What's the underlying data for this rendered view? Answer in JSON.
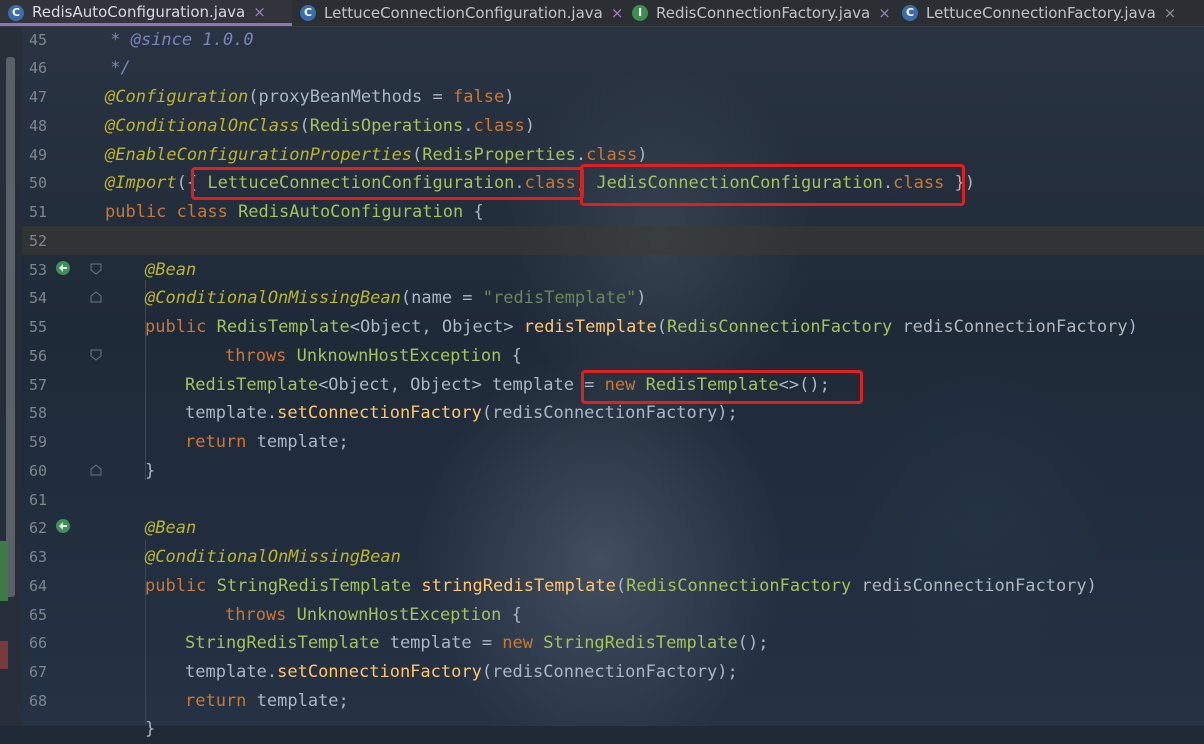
{
  "tabs": [
    {
      "label": "RedisAutoConfiguration.java",
      "icon": "C",
      "active": true
    },
    {
      "label": "LettuceConnectionConfiguration.java",
      "icon": "C",
      "active": false
    },
    {
      "label": "RedisConnectionFactory.java",
      "icon": "I",
      "active": false
    },
    {
      "label": "LettuceConnectionFactory.java",
      "icon": "C",
      "active": false
    }
  ],
  "close_glyph": "×",
  "line_numbers": [
    "45",
    "46",
    "47",
    "48",
    "49",
    "50",
    "51",
    "52",
    "53",
    "54",
    "55",
    "56",
    "57",
    "58",
    "59",
    "60",
    "61",
    "62",
    "63",
    "64",
    "65",
    "66",
    "67",
    "68"
  ],
  "code": {
    "l45_a": " * ",
    "l45_b": "@since",
    "l45_c": " 1.0.0",
    "l46": " */",
    "l47_a": "@Configuration",
    "l47_b": "(proxyBeanMethods = ",
    "l47_c": "false",
    "l47_d": ")",
    "l48_a": "@ConditionalOnClass",
    "l48_b": "(",
    "l48_c": "RedisOperations",
    "l48_d": ".",
    "l48_e": "class",
    "l48_f": ")",
    "l49_a": "@EnableConfigurationProperties",
    "l49_b": "(",
    "l49_c": "RedisProperties",
    "l49_d": ".",
    "l49_e": "class",
    "l49_f": ")",
    "l50_a": "@Import",
    "l50_b": "({ ",
    "l50_c": "LettuceConnectionConfiguration",
    "l50_d": ".",
    "l50_e": "class",
    "l50_f": ", ",
    "l50_g": "JedisConnectionConfiguration",
    "l50_h": ".",
    "l50_i": "class",
    "l50_j": " })",
    "l51_a": "public class ",
    "l51_b": "RedisAutoConfiguration",
    "l51_c": " {",
    "l53": "@Bean",
    "l54_a": "@ConditionalOnMissingBean",
    "l54_b": "(name = ",
    "l54_c": "\"redisTemplate\"",
    "l54_d": ")",
    "l55_a": "public ",
    "l55_b": "RedisTemplate",
    "l55_c": "<Object, Object> ",
    "l55_d": "redisTemplate",
    "l55_e": "(",
    "l55_f": "RedisConnectionFactory ",
    "l55_g": "redisConnectionFactory",
    "l55_h": ")",
    "l56_a": "throws ",
    "l56_b": "UnknownHostException",
    "l56_c": " {",
    "l57_a": "RedisTemplate",
    "l57_b": "<Object, Object> template = ",
    "l57_c": "new ",
    "l57_d": "RedisTemplate",
    "l57_e": "<>();",
    "l58_a": "template.",
    "l58_b": "setConnectionFactory",
    "l58_c": "(redisConnectionFactory);",
    "l59_a": "return ",
    "l59_b": "template;",
    "l60": "}",
    "l62": "@Bean",
    "l63": "@ConditionalOnMissingBean",
    "l64_a": "public ",
    "l64_b": "StringRedisTemplate ",
    "l64_c": "stringRedisTemplate",
    "l64_d": "(",
    "l64_e": "RedisConnectionFactory ",
    "l64_f": "redisConnectionFactory",
    "l64_g": ")",
    "l65_a": "throws ",
    "l65_b": "UnknownHostException",
    "l65_c": " {",
    "l66_a": "StringRedisTemplate ",
    "l66_b": "template = ",
    "l66_c": "new ",
    "l66_d": "StringRedisTemplate",
    "l66_e": "();",
    "l67_a": "template.",
    "l67_b": "setConnectionFactory",
    "l67_c": "(redisConnectionFactory);",
    "l68_a": "return ",
    "l68_b": "template;",
    "l69": "}"
  },
  "colors": {
    "annotation_box": "#e02020",
    "active_tab_underline": "#8f73b8"
  }
}
